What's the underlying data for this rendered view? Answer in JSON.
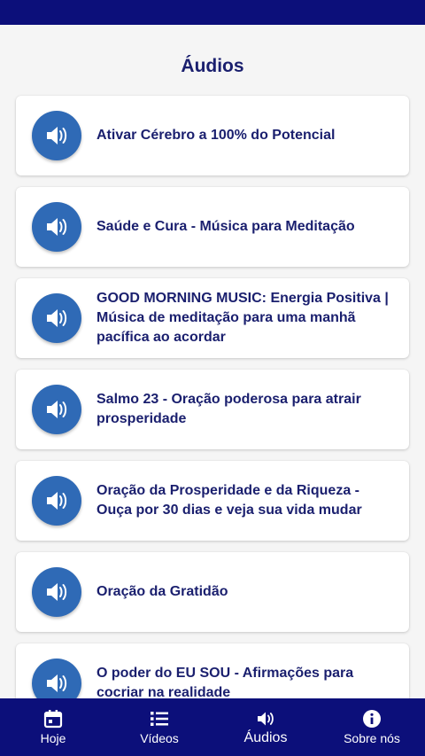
{
  "page": {
    "title": "Áudios"
  },
  "audios": [
    {
      "title": "Ativar Cérebro a 100% do Potencial",
      "icon": "speaker-icon"
    },
    {
      "title": "Saúde e Cura - Música para  Meditação",
      "icon": "speaker-icon"
    },
    {
      "title": "GOOD MORNING MUSIC: Energia Positiva | Música de meditação para uma manhã pacífica ao acordar",
      "icon": "speaker-icon"
    },
    {
      "title": "Salmo 23 - Oração poderosa para atrair prosperidade",
      "icon": "speaker-icon"
    },
    {
      "title": "Oração da Prosperidade e da Riqueza - Ouça por 30 dias e veja sua vida mudar",
      "icon": "speaker-icon"
    },
    {
      "title": "Oração da Gratidão",
      "icon": "speaker-icon"
    },
    {
      "title": "O poder do EU SOU - Afirmações para cocriar na realidade",
      "icon": "speaker-icon"
    }
  ],
  "nav": {
    "items": [
      {
        "label": "Hoje",
        "icon": "calendar-icon"
      },
      {
        "label": "Vídeos",
        "icon": "list-icon"
      },
      {
        "label": "Áudios",
        "icon": "speaker-icon",
        "active": true
      },
      {
        "label": "Sobre nós",
        "icon": "info-icon"
      }
    ]
  },
  "colors": {
    "bar": "#0c0f7a",
    "title_text": "#1a1f6e",
    "icon_circle": "#2f6ab6",
    "background": "#f5f5f5"
  }
}
